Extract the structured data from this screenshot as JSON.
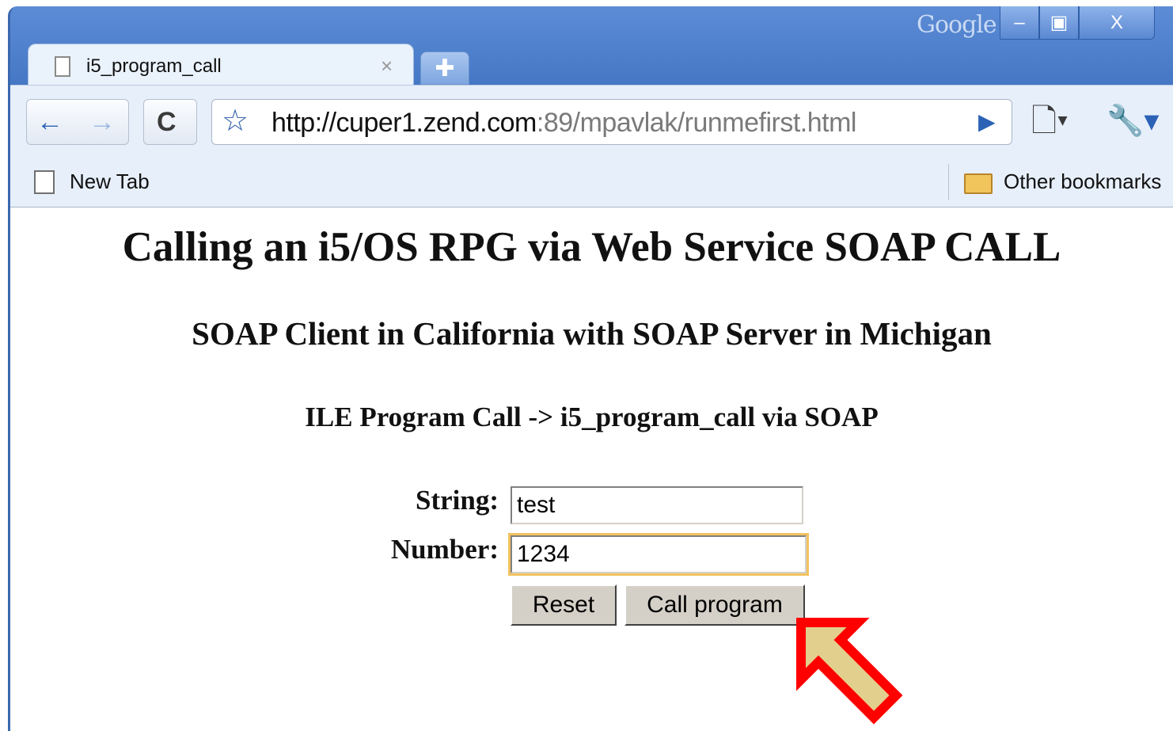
{
  "browser": {
    "branding": "Google",
    "window_controls": {
      "minimize": "‒",
      "maximize": "▣",
      "close": "X"
    },
    "tab": {
      "title": "i5_program_call",
      "close_glyph": "×"
    },
    "new_tab_glyph": "✚",
    "address_bar": {
      "url_host": "http://cuper1.zend.com",
      "url_rest": ":89/mpavlak/runmefirst.html"
    },
    "bookmarks": {
      "left_item": "New Tab",
      "right_item": "Other bookmarks"
    },
    "icons": {
      "back": "←",
      "forward": "→",
      "reload": "C",
      "star": "☆",
      "go": "▶",
      "page_menu": "🗋▾",
      "wrench_menu": "🔧▾"
    }
  },
  "page": {
    "title": "Calling an i5/OS RPG via Web Service SOAP CALL",
    "subtitle": "SOAP Client in California with SOAP Server in Michigan",
    "heading": "ILE Program Call -> i5_program_call via SOAP",
    "form": {
      "string_label": "String:",
      "string_value": "test",
      "number_label": "Number:",
      "number_value": "1234",
      "reset_label": "Reset",
      "submit_label": "Call program"
    }
  },
  "colors": {
    "arrow_outline": "#ff0000",
    "arrow_fill": "#e2cf8e",
    "focus_ring": "#f2c35f",
    "window_frame": "#4f7fc9"
  }
}
